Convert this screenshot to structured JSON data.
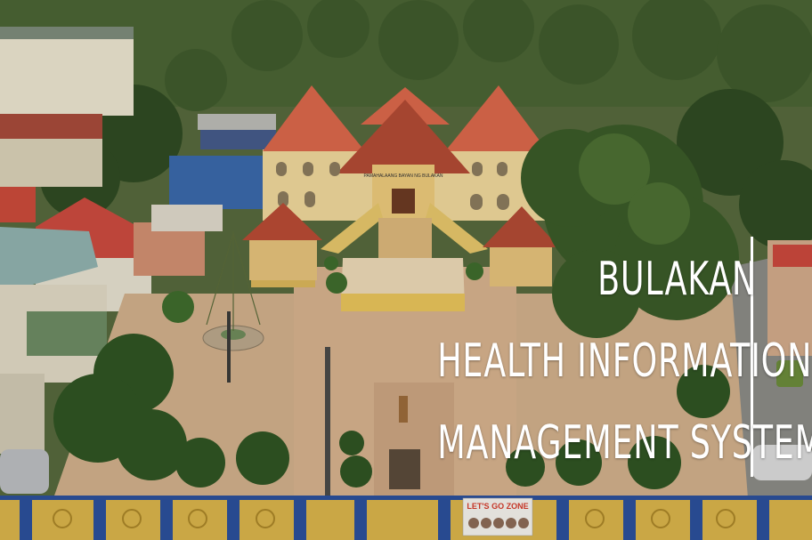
{
  "title": {
    "line1": "BULAKAN",
    "line2": "HEALTH INFORMATION",
    "line3": "MANAGEMENT SYSTEM"
  },
  "banner": {
    "text": "LET'S GO ZONE"
  },
  "building_sign": {
    "text": "PAMAHALAANG BAYAN NG BULAKAN"
  },
  "colors": {
    "roof": "#d8664a",
    "roof_dark": "#b04a33",
    "wall": "#ecd59a",
    "plaza": "#cfae8a",
    "foliage": "#3d5a2a",
    "fence_blue": "#2b4f9a",
    "fence_gold": "#d7b24a",
    "title_text": "#ffffff"
  }
}
